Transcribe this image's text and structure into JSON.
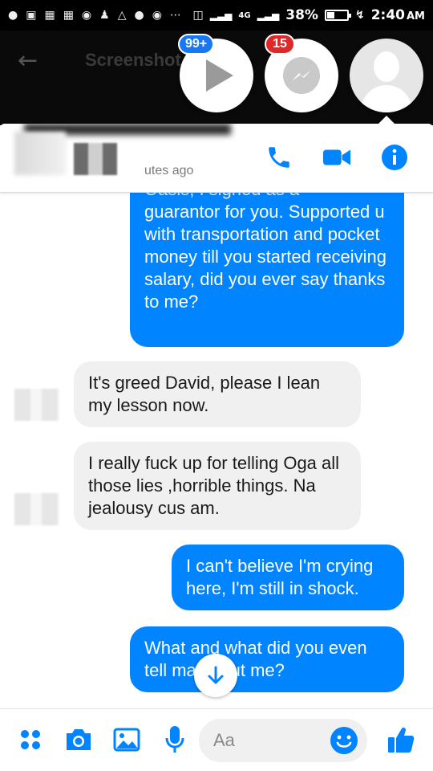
{
  "status_bar": {
    "battery": "38%",
    "battery_level": 0.38,
    "network": "4G",
    "time": "2:40",
    "ampm": "AM"
  },
  "underlying_app": {
    "title": "Screenshot"
  },
  "chat_heads": {
    "video_badge": "99+",
    "messenger_badge": "15"
  },
  "conversation": {
    "active_status": "utes ago",
    "messages": [
      {
        "direction": "sent",
        "text": "guarantor for you. Supported u with transportation and pocket money till you started receiving salary, did you ever say thanks to me?",
        "cut_top_text": "Oasis, I signed as a"
      },
      {
        "direction": "received",
        "text": "It's greed David, please I lean my lesson now."
      },
      {
        "direction": "received",
        "text": "I really fuck up for telling Oga all those lies ,horrible things. Na jealousy cus am."
      },
      {
        "direction": "sent",
        "text": "I can't believe I'm crying here, I'm still in shock."
      },
      {
        "direction": "sent",
        "text": "What and what did you even tell ma about me?"
      }
    ]
  },
  "composer": {
    "placeholder": "Aa"
  },
  "colors": {
    "accent": "#0084ff",
    "received_bubble": "#f0f0f0",
    "badge_blue": "#1877f2",
    "badge_red": "#e02828",
    "emoji_yellow": "#ffc107"
  },
  "icons": [
    "whatsapp-icon",
    "gallery-icon",
    "grid-icon",
    "messenger-icon",
    "person-icon",
    "warning-icon",
    "back-arrow-icon",
    "play-icon",
    "avatar-icon",
    "phone-icon",
    "video-icon",
    "info-icon",
    "scroll-down-arrow-icon",
    "more-dots-icon",
    "camera-icon",
    "image-icon",
    "mic-icon",
    "emoji-icon",
    "thumbs-up-icon"
  ]
}
